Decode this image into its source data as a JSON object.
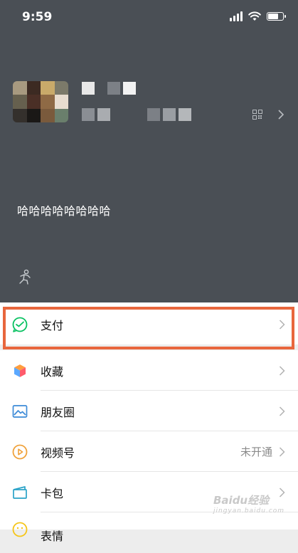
{
  "status_bar": {
    "time": "9:59",
    "battery_level": 0.75
  },
  "profile": {
    "status_text": "哈哈哈哈哈哈哈哈"
  },
  "menu": {
    "items": [
      {
        "label": "支付",
        "value": "",
        "icon": "wechat-pay-icon"
      },
      {
        "label": "收藏",
        "value": "",
        "icon": "favorites-cube-icon"
      },
      {
        "label": "朋友圈",
        "value": "",
        "icon": "moments-picture-icon"
      },
      {
        "label": "视频号",
        "value": "未开通",
        "icon": "channels-play-icon"
      },
      {
        "label": "卡包",
        "value": "",
        "icon": "card-wallet-icon"
      },
      {
        "label": "表情",
        "value": "",
        "icon": "sticker-smile-icon"
      }
    ]
  },
  "watermark": {
    "brand": "Baidu经验",
    "url": "jingyan.baidu.com"
  },
  "colors": {
    "highlight": "#e8663d",
    "header_bg": "#4a4f55",
    "pay_green": "#07c160"
  }
}
